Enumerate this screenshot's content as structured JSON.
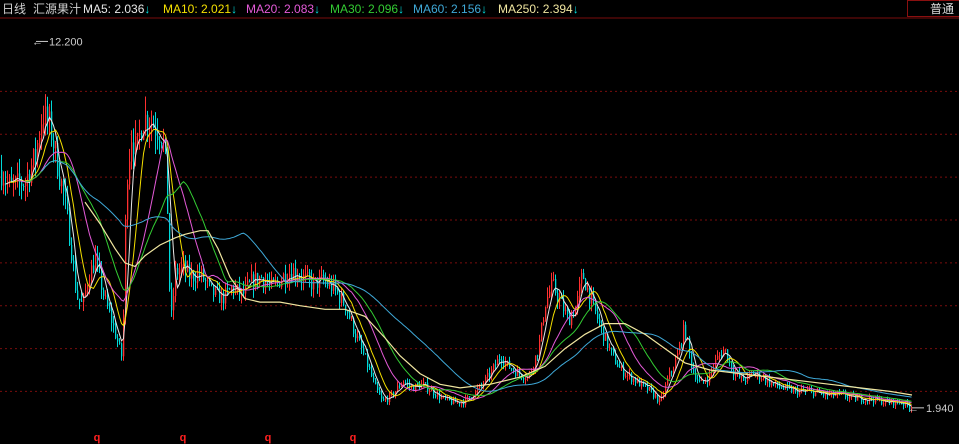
{
  "header": {
    "period": "日线",
    "stock_name": "汇源果汁",
    "ma": [
      {
        "label": "MA5:",
        "value": "2.036",
        "arrow": "↓",
        "color": "#e8e8e8"
      },
      {
        "label": "MA10:",
        "value": "2.021",
        "arrow": "↓",
        "color": "#f5e000"
      },
      {
        "label": "MA20:",
        "value": "2.083",
        "arrow": "↓",
        "color": "#e45ad8"
      },
      {
        "label": "MA30:",
        "value": "2.096",
        "arrow": "↓",
        "color": "#33cc33"
      },
      {
        "label": "MA60:",
        "value": "2.156",
        "arrow": "↓",
        "color": "#3fa9d8"
      },
      {
        "label": "MA250:",
        "value": "2.394",
        "arrow": "↓",
        "color": "#f0e6a0"
      }
    ],
    "mode_button": "普通"
  },
  "colors": {
    "up": "#ff3030",
    "down": "#00d8d8",
    "grid": "#7a0d0d",
    "ma5": "#e8e8e8",
    "ma10": "#f5e000",
    "ma20": "#e45ad8",
    "ma30": "#33cc33",
    "ma60": "#3fa9d8",
    "ma250": "#f0e6a0",
    "marker": "#ff2020",
    "annotation": "#cccccc"
  },
  "annotations": {
    "high": "12.200",
    "low": "1.940"
  },
  "event_markers": [
    "q",
    "q",
    "q",
    "q"
  ],
  "chart_data": {
    "type": "candlestick",
    "y_range": [
      1.6,
      12.8
    ],
    "price_path": [
      [
        0,
        8.6
      ],
      [
        10,
        8.1
      ],
      [
        25,
        8.3
      ],
      [
        35,
        9.0
      ],
      [
        42,
        10.2
      ],
      [
        50,
        9.8
      ],
      [
        58,
        8.6
      ],
      [
        64,
        7.8
      ],
      [
        70,
        6.6
      ],
      [
        76,
        5.1
      ],
      [
        82,
        4.8
      ],
      [
        88,
        5.6
      ],
      [
        95,
        6.1
      ],
      [
        104,
        5.0
      ],
      [
        112,
        4.3
      ],
      [
        118,
        3.7
      ],
      [
        122,
        3.3
      ],
      [
        126,
        8.3
      ],
      [
        131,
        9.6
      ],
      [
        136,
        9.1
      ],
      [
        142,
        10.0
      ],
      [
        148,
        10.1
      ],
      [
        155,
        9.8
      ],
      [
        162,
        9.6
      ],
      [
        166,
        8.6
      ],
      [
        170,
        4.2
      ],
      [
        175,
        5.7
      ],
      [
        182,
        5.9
      ],
      [
        190,
        5.6
      ],
      [
        200,
        5.7
      ],
      [
        210,
        5.2
      ],
      [
        222,
        5.0
      ],
      [
        232,
        5.3
      ],
      [
        242,
        5.1
      ],
      [
        252,
        5.5
      ],
      [
        262,
        5.6
      ],
      [
        272,
        5.3
      ],
      [
        282,
        5.6
      ],
      [
        292,
        5.8
      ],
      [
        302,
        5.6
      ],
      [
        312,
        5.4
      ],
      [
        322,
        5.5
      ],
      [
        333,
        5.3
      ],
      [
        345,
        4.8
      ],
      [
        355,
        4.0
      ],
      [
        365,
        3.3
      ],
      [
        375,
        2.5
      ],
      [
        382,
        2.1
      ],
      [
        392,
        2.3
      ],
      [
        402,
        2.7
      ],
      [
        412,
        2.5
      ],
      [
        422,
        2.6
      ],
      [
        432,
        2.4
      ],
      [
        442,
        2.2
      ],
      [
        452,
        2.1
      ],
      [
        462,
        2.1
      ],
      [
        472,
        2.3
      ],
      [
        482,
        2.6
      ],
      [
        492,
        3.0
      ],
      [
        500,
        3.4
      ],
      [
        508,
        3.1
      ],
      [
        518,
        2.9
      ],
      [
        528,
        2.8
      ],
      [
        538,
        3.6
      ],
      [
        545,
        4.9
      ],
      [
        552,
        5.4
      ],
      [
        560,
        4.9
      ],
      [
        568,
        4.4
      ],
      [
        576,
        4.8
      ],
      [
        582,
        5.7
      ],
      [
        590,
        5.0
      ],
      [
        600,
        4.2
      ],
      [
        610,
        3.5
      ],
      [
        620,
        3.0
      ],
      [
        630,
        2.8
      ],
      [
        640,
        2.6
      ],
      [
        650,
        2.4
      ],
      [
        660,
        2.1
      ],
      [
        668,
        2.8
      ],
      [
        676,
        3.3
      ],
      [
        684,
        4.2
      ],
      [
        692,
        3.0
      ],
      [
        700,
        2.6
      ],
      [
        708,
        2.8
      ],
      [
        716,
        3.3
      ],
      [
        724,
        3.6
      ],
      [
        732,
        3.0
      ],
      [
        742,
        2.7
      ],
      [
        752,
        2.9
      ],
      [
        762,
        2.8
      ],
      [
        772,
        2.6
      ],
      [
        782,
        2.5
      ],
      [
        795,
        2.4
      ],
      [
        810,
        2.4
      ],
      [
        825,
        2.3
      ],
      [
        840,
        2.3
      ],
      [
        855,
        2.2
      ],
      [
        870,
        2.2
      ],
      [
        885,
        2.1
      ],
      [
        900,
        2.1
      ],
      [
        912,
        1.94
      ]
    ],
    "ma250_path": [
      [
        85,
        7.7
      ],
      [
        100,
        7.1
      ],
      [
        115,
        6.4
      ],
      [
        125,
        6.0
      ],
      [
        135,
        5.9
      ],
      [
        145,
        6.2
      ],
      [
        160,
        6.5
      ],
      [
        175,
        6.7
      ],
      [
        185,
        6.8
      ],
      [
        200,
        6.9
      ],
      [
        208,
        6.9
      ],
      [
        218,
        6.4
      ],
      [
        230,
        5.6
      ],
      [
        245,
        5.0
      ],
      [
        260,
        4.9
      ],
      [
        280,
        4.9
      ],
      [
        300,
        4.8
      ],
      [
        325,
        4.7
      ],
      [
        345,
        4.7
      ],
      [
        365,
        4.5
      ],
      [
        385,
        3.9
      ],
      [
        400,
        3.4
      ],
      [
        420,
        2.9
      ],
      [
        440,
        2.6
      ],
      [
        460,
        2.5
      ],
      [
        490,
        2.6
      ],
      [
        520,
        2.8
      ],
      [
        545,
        3.1
      ],
      [
        565,
        3.6
      ],
      [
        585,
        4.0
      ],
      [
        605,
        4.3
      ],
      [
        625,
        4.3
      ],
      [
        645,
        4.0
      ],
      [
        665,
        3.6
      ],
      [
        685,
        3.2
      ],
      [
        710,
        3.0
      ],
      [
        740,
        2.9
      ],
      [
        770,
        2.8
      ],
      [
        800,
        2.7
      ],
      [
        830,
        2.6
      ],
      [
        860,
        2.5
      ],
      [
        890,
        2.4
      ],
      [
        912,
        2.3
      ]
    ],
    "high": {
      "value": 12.2,
      "index_x": 36
    },
    "low": {
      "value": 1.94,
      "index_x": 912
    },
    "gridlines": [
      10.8,
      9.6,
      8.4,
      7.2,
      6.0,
      4.8,
      3.6,
      2.4
    ],
    "event_marker_x": [
      97,
      183,
      268,
      353
    ]
  }
}
